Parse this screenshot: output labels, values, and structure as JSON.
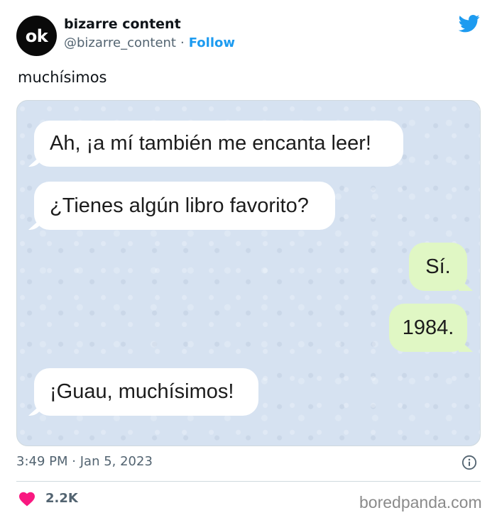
{
  "author": {
    "avatar_text": "ok",
    "display_name": "bizarre content",
    "handle": "@bizarre_content",
    "separator": "·",
    "follow_label": "Follow"
  },
  "tweet": {
    "text": "muchísimos",
    "time": "3:49 PM",
    "separator": "·",
    "date": "Jan 5, 2023",
    "likes": "2.2K"
  },
  "chat": {
    "messages": [
      {
        "side": "incoming",
        "text": "Ah, ¡a mí también me encanta leer!"
      },
      {
        "side": "incoming",
        "text": "¿Tienes algún libro favorito?"
      },
      {
        "side": "outgoing",
        "text": "Sí."
      },
      {
        "side": "outgoing",
        "text": "1984."
      },
      {
        "side": "incoming",
        "text": "¡Guau, muchísimos!"
      }
    ]
  },
  "watermark": "boredpanda.com",
  "colors": {
    "accent": "#1d9bf0",
    "like_heart": "#f91880",
    "incoming_bubble": "#ffffff",
    "outgoing_bubble": "#e0f7c4",
    "chat_background": "#d6e2f1"
  },
  "icons": {
    "brand": "twitter-bird-icon",
    "info": "info-icon",
    "like": "heart-icon"
  }
}
